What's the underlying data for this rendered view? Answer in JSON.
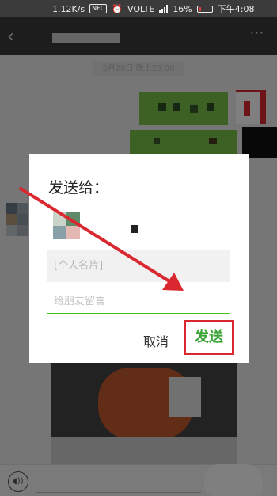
{
  "status_bar": {
    "speed": "1.12K/s",
    "nfc": "NFC",
    "volte": "VOLTE",
    "battery": "16%",
    "time": "下午4:08"
  },
  "nav": {
    "back_icon": "chevron-left-icon",
    "more_icon": "more-icon"
  },
  "chat": {
    "timestamp": "5月20日 晚上23:06"
  },
  "dialog": {
    "title": "发送给：",
    "card_preview": "[个人名片]",
    "message_placeholder": "给朋友留言",
    "cancel": "取消",
    "send": "发送"
  },
  "colors": {
    "accent": "#45c01a",
    "highlight": "#d9282f"
  }
}
